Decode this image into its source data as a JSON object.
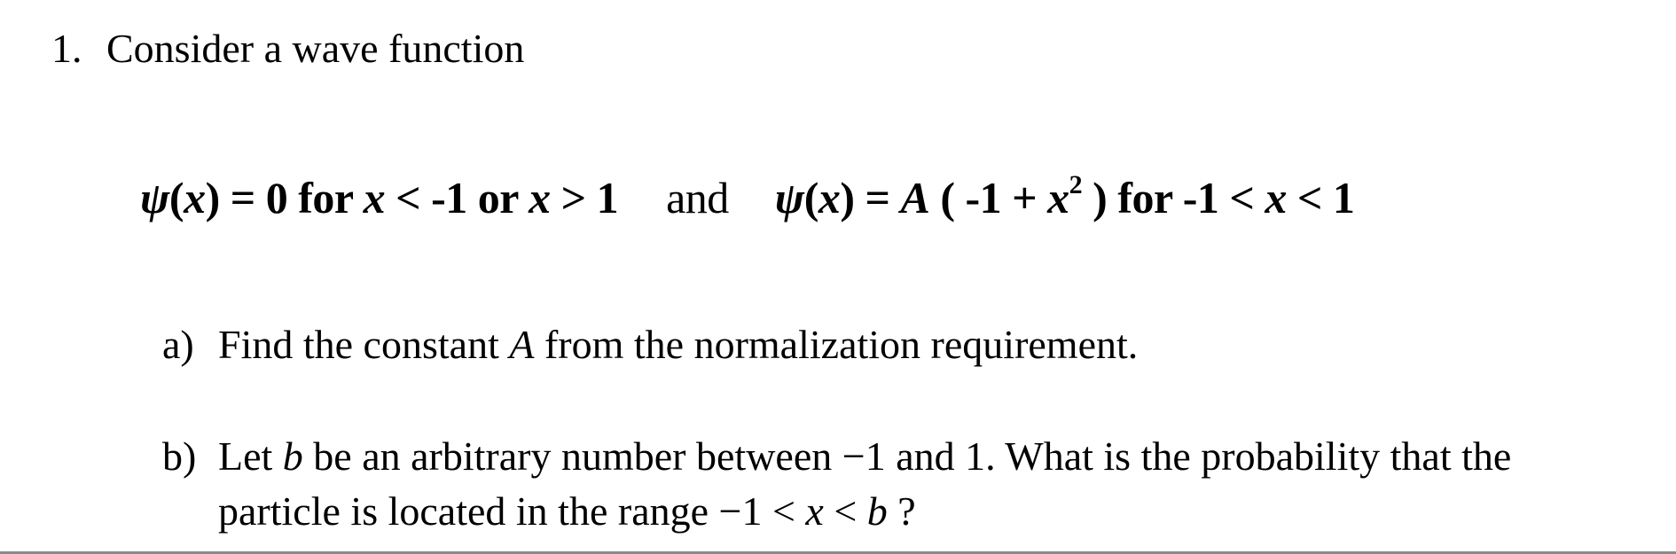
{
  "question": {
    "number": "1.",
    "heading": "Consider a wave function"
  },
  "equation": {
    "psi": "ψ",
    "part1": {
      "lhs_open": "(",
      "var": "x",
      "lhs_close": ") = 0 for ",
      "var2": "x",
      "cond1": " < -1 or ",
      "var3": "x",
      "cond2": " > 1"
    },
    "connector": "and",
    "part2": {
      "lhs_open": "(",
      "var": "x",
      "lhs_close": ") = ",
      "const": "A",
      "paren_open": " ( -1 + ",
      "var2": "x",
      "exponent": "2",
      "paren_close": " ) for -1 < ",
      "var3": "x",
      "cond_end": " < 1"
    }
  },
  "parts": [
    {
      "label": "a)",
      "text_before": "Find the constant ",
      "italic": "A",
      "text_after": " from the normalization requirement."
    },
    {
      "label": "b)",
      "line1_before": "Let ",
      "line1_italic": "b",
      "line1_after": " be an arbitrary number between −1 and 1. What is the probability that the",
      "line2_before": "particle is located in the range −1 < ",
      "line2_italic_x": "x",
      "line2_mid": " < ",
      "line2_italic_b": "b",
      "line2_after": " ?"
    }
  ],
  "colors": {
    "text": "#000000",
    "background": "#ffffff",
    "rule": "#8a8a8a"
  }
}
